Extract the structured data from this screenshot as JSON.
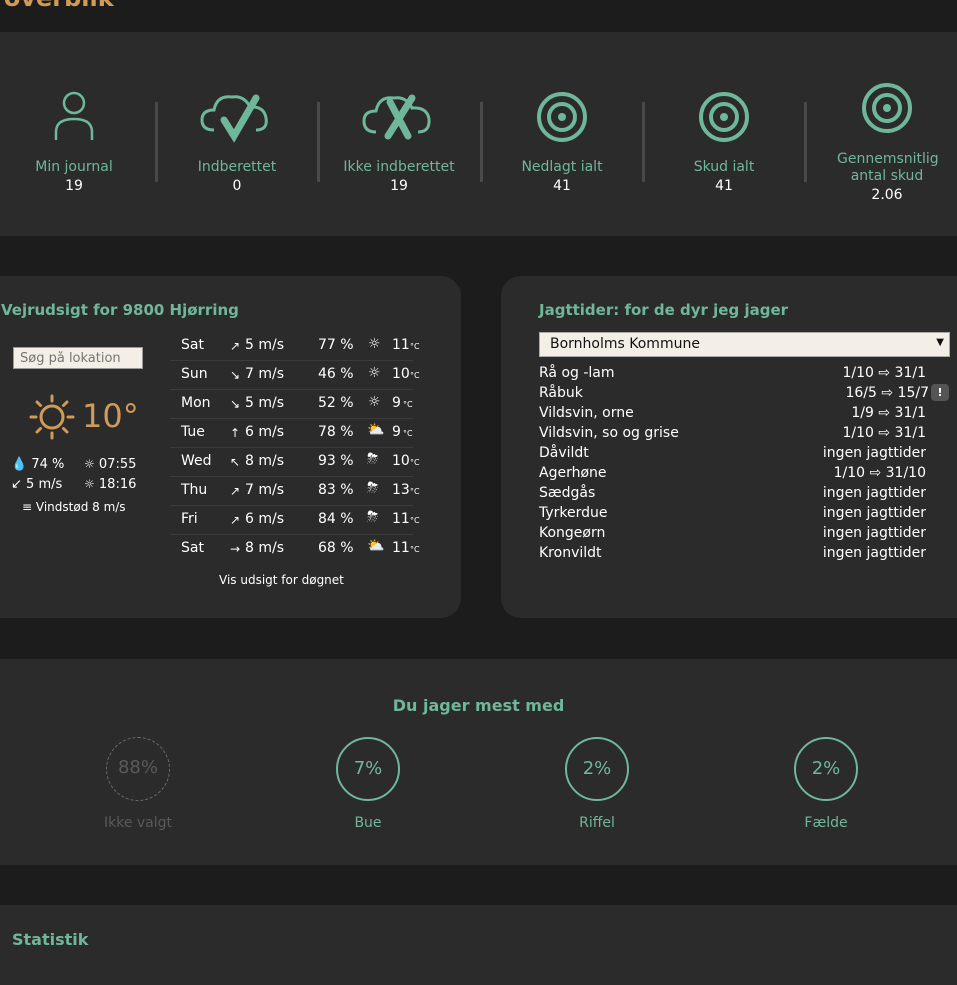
{
  "page_title": "t overblik",
  "stats": [
    {
      "label": "Min journal",
      "value": "19",
      "icon": "user-icon"
    },
    {
      "label": "Indberettet",
      "value": "0",
      "icon": "cloud-check-icon"
    },
    {
      "label": "Ikke indberettet",
      "value": "19",
      "icon": "cloud-x-icon"
    },
    {
      "label": "Nedlagt ialt",
      "value": "41",
      "icon": "target-icon"
    },
    {
      "label": "Skud ialt",
      "value": "41",
      "icon": "target-icon"
    },
    {
      "label": "Gennemsnitlig antal skud",
      "value": "2.06",
      "icon": "target-icon"
    }
  ],
  "weather": {
    "title": "Vejrudsigt for 9800 Hjørring",
    "search_placeholder": "Søg på lokation",
    "current_temp": "10°",
    "humidity": "74 %",
    "wind": "5 m/s",
    "sunrise": "07:55",
    "sunset": "18:16",
    "gust": "Vindstød 8 m/s",
    "forecast": [
      {
        "day": "Sat",
        "arrow": "↗",
        "wind": "5 m/s",
        "humidity": "77 %",
        "icon": "sun-icon",
        "temp": "11",
        "unit": "°C"
      },
      {
        "day": "Sun",
        "arrow": "↘",
        "wind": "7 m/s",
        "humidity": "46 %",
        "icon": "sun-icon",
        "temp": "10",
        "unit": "°C"
      },
      {
        "day": "Mon",
        "arrow": "↘",
        "wind": "5 m/s",
        "humidity": "52 %",
        "icon": "sun-icon",
        "temp": "9",
        "unit": "°C"
      },
      {
        "day": "Tue",
        "arrow": "↑",
        "wind": "6 m/s",
        "humidity": "78 %",
        "icon": "partly-cloudy-icon",
        "temp": "9",
        "unit": "°C"
      },
      {
        "day": "Wed",
        "arrow": "↖",
        "wind": "8 m/s",
        "humidity": "93 %",
        "icon": "rain-sun-icon",
        "temp": "10",
        "unit": "°C"
      },
      {
        "day": "Thu",
        "arrow": "↗",
        "wind": "7 m/s",
        "humidity": "83 %",
        "icon": "rain-sun-icon",
        "temp": "13",
        "unit": "°C"
      },
      {
        "day": "Fri",
        "arrow": "↗",
        "wind": "6 m/s",
        "humidity": "84 %",
        "icon": "rain-sun-icon",
        "temp": "11",
        "unit": "°C"
      },
      {
        "day": "Sat",
        "arrow": "→",
        "wind": "8 m/s",
        "humidity": "68 %",
        "icon": "partly-cloudy-icon",
        "temp": "11",
        "unit": "°C"
      }
    ],
    "link": "Vis udsigt for døgnet"
  },
  "hunting": {
    "title": "Jagttider: for de dyr jeg jager",
    "selected_municipality": "Bornholms Kommune",
    "rows": [
      {
        "name": "Rå og -lam",
        "period": "1/10 ⇨ 31/1"
      },
      {
        "name": "Råbuk",
        "period": "16/5 ⇨ 15/7"
      },
      {
        "name": "Vildsvin, orne",
        "period": "1/9 ⇨ 31/1"
      },
      {
        "name": "Vildsvin, so og grise",
        "period": "1/10 ⇨ 31/1"
      },
      {
        "name": "Dåvildt",
        "period": "ingen jagttider"
      },
      {
        "name": "Agerhøne",
        "period": "1/10 ⇨ 31/10"
      },
      {
        "name": "Sædgås",
        "period": "ingen jagttider"
      },
      {
        "name": "Tyrkerdue",
        "period": "ingen jagttider"
      },
      {
        "name": "Kongeørn",
        "period": "ingen jagttider"
      },
      {
        "name": "Kronvildt",
        "period": "ingen jagttider"
      }
    ],
    "badge": "!"
  },
  "weapons": {
    "title": "Du jager mest med",
    "items": [
      {
        "percent": "88%",
        "label": "Ikke valgt"
      },
      {
        "percent": "7%",
        "label": "Bue"
      },
      {
        "percent": "2%",
        "label": "Riffel"
      },
      {
        "percent": "2%",
        "label": "Fælde"
      }
    ]
  },
  "statistik": {
    "title": "Statistik"
  },
  "colors": {
    "accent": "#6fb79a",
    "orange": "#d09a58",
    "card": "#2b2b2b",
    "background": "#1c1c1c"
  }
}
